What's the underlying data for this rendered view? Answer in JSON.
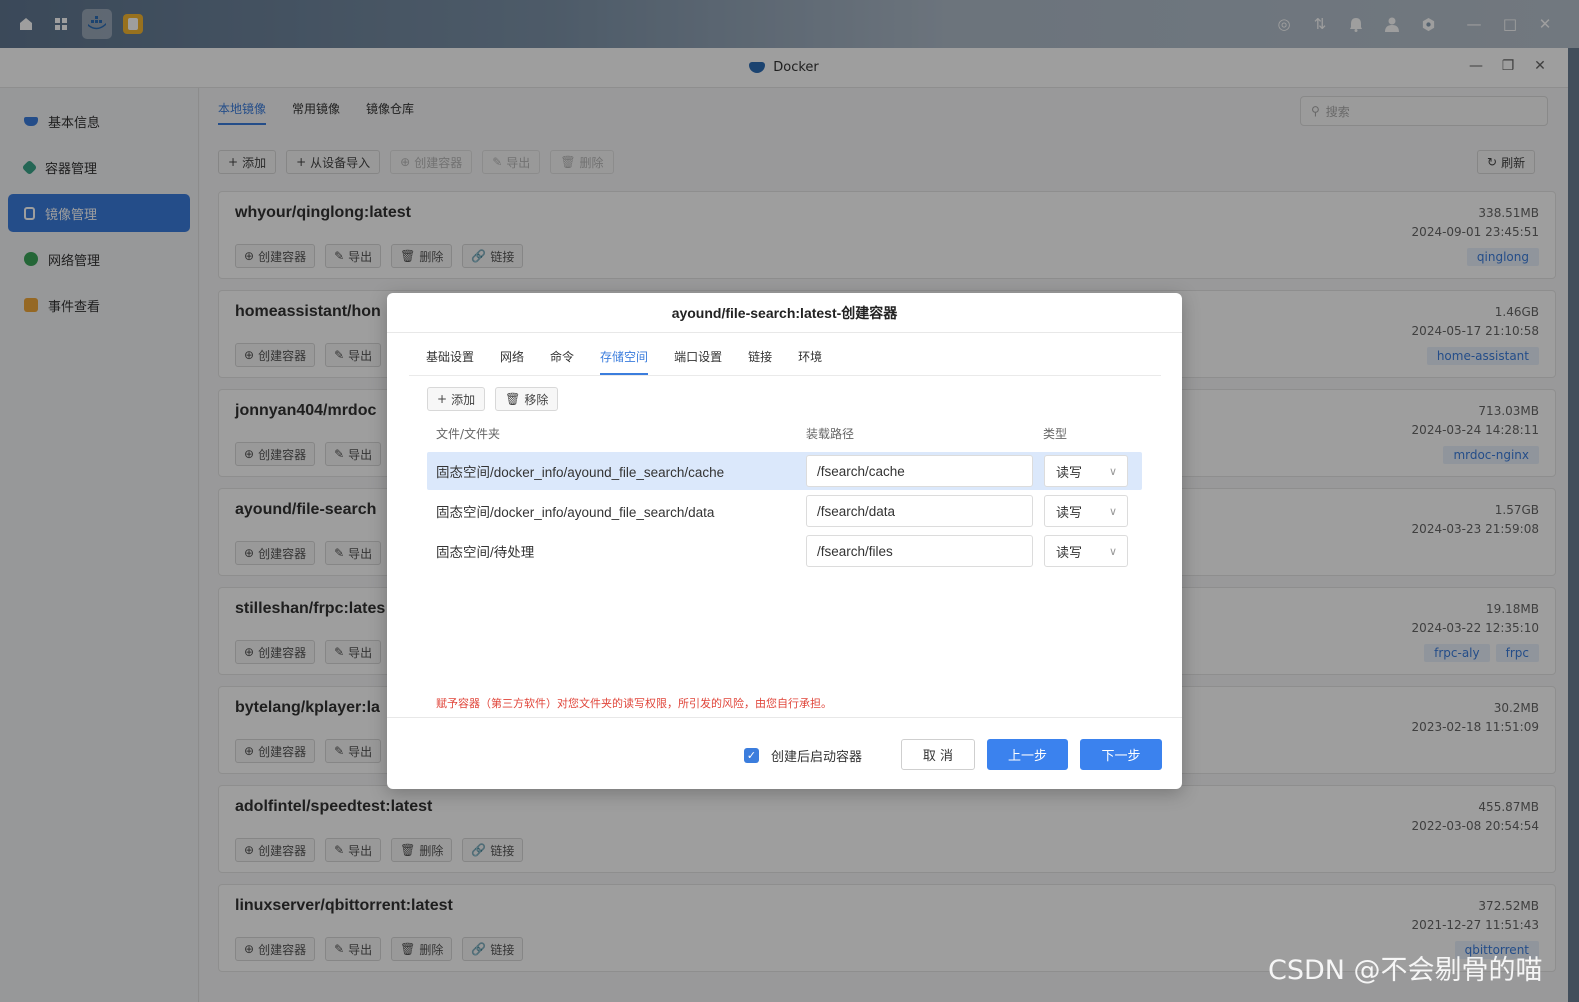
{
  "window": {
    "title": "Docker"
  },
  "colors": {
    "accent": "#3b7ddd",
    "primary_button": "#3b82ee",
    "warning": "#e0453a",
    "tag_bg": "#e9f1fc"
  },
  "sidebar": {
    "items": [
      {
        "label": "基本信息",
        "icon": "docker-icon"
      },
      {
        "label": "容器管理",
        "icon": "cube-icon"
      },
      {
        "label": "镜像管理",
        "icon": "image-icon",
        "active": true
      },
      {
        "label": "网络管理",
        "icon": "globe-icon"
      },
      {
        "label": "事件查看",
        "icon": "event-log-icon"
      }
    ]
  },
  "main": {
    "tabs": [
      "本地镜像",
      "常用镜像",
      "镜像仓库"
    ],
    "search_placeholder": "搜索",
    "toolbar": {
      "add": "添加",
      "import": "从设备导入",
      "create": "创建容器",
      "export": "导出",
      "delete": "删除",
      "refresh": "刷新"
    },
    "card_actions": {
      "create": "创建容器",
      "export": "导出",
      "delete": "删除",
      "link": "链接"
    },
    "images": [
      {
        "name": "whyour/qinglong:latest",
        "size": "338.51MB",
        "date": "2024-09-01 23:45:51",
        "tags": [
          "qinglong"
        ]
      },
      {
        "name": "homeassistant/hon",
        "size": "1.46GB",
        "date": "2024-05-17 21:10:58",
        "tags": [
          "home-assistant"
        ]
      },
      {
        "name": "jonnyan404/mrdoc",
        "size": "713.03MB",
        "date": "2024-03-24 14:28:11",
        "tags": [
          "mrdoc-nginx"
        ]
      },
      {
        "name": "ayound/file-search",
        "size": "1.57GB",
        "date": "2024-03-23 21:59:08",
        "tags": []
      },
      {
        "name": "stilleshan/frpc:lates",
        "size": "19.18MB",
        "date": "2024-03-22 12:35:10",
        "tags": [
          "frpc-aly",
          "frpc"
        ]
      },
      {
        "name": "bytelang/kplayer:la",
        "size": "30.2MB",
        "date": "2023-02-18 11:51:09",
        "tags": []
      },
      {
        "name": "adolfintel/speedtest:latest",
        "size": "455.87MB",
        "date": "2022-03-08 20:54:54",
        "tags": []
      },
      {
        "name": "linuxserver/qbittorrent:latest",
        "size": "372.52MB",
        "date": "2021-12-27 11:51:43",
        "tags": [
          "qbittorrent"
        ]
      }
    ]
  },
  "dialog": {
    "title": "ayound/file-search:latest-创建容器",
    "tabs": [
      "基础设置",
      "网络",
      "命令",
      "存储空间",
      "端口设置",
      "链接",
      "环境"
    ],
    "active_tab": "存储空间",
    "tools": {
      "add": "添加",
      "remove": "移除"
    },
    "columns": {
      "path": "文件/文件夹",
      "mount": "装载路径",
      "type": "类型"
    },
    "volumes": [
      {
        "path": "固态空间/docker_info/ayound_file_search/cache",
        "mount": "/fsearch/cache",
        "type": "读写"
      },
      {
        "path": "固态空间/docker_info/ayound_file_search/data",
        "mount": "/fsearch/data",
        "type": "读写"
      },
      {
        "path": "固态空间/待处理",
        "mount": "/fsearch/files",
        "type": "读写"
      }
    ],
    "warning": "赋予容器（第三方软件）对您文件夹的读写权限，所引发的风险，由您自行承担。",
    "autostart_label": "创建后启动容器",
    "autostart_checked": true,
    "buttons": {
      "cancel": "取 消",
      "prev": "上一步",
      "next": "下一步"
    }
  },
  "watermark": "CSDN @不会剔骨的喵"
}
